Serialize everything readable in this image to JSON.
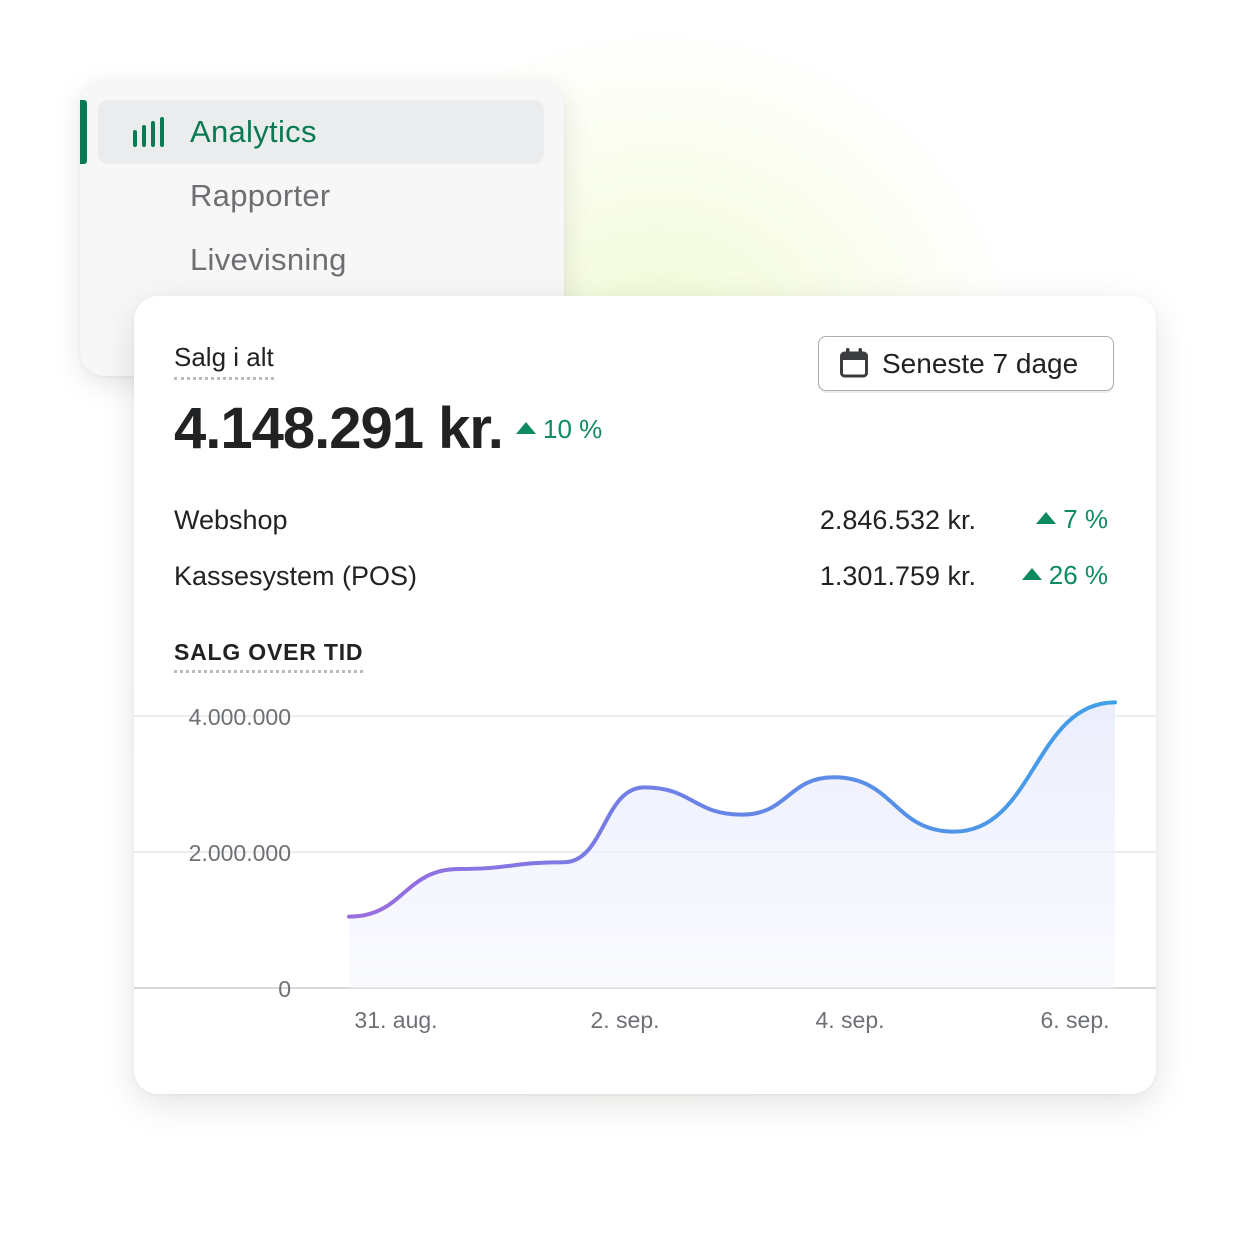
{
  "nav": {
    "items": [
      {
        "label": "Analytics",
        "active": true,
        "icon": "bar-chart-icon"
      },
      {
        "label": "Rapporter",
        "active": false
      },
      {
        "label": "Livevisning",
        "active": false
      }
    ]
  },
  "summary": {
    "title": "Salg i alt",
    "date_range": {
      "icon": "calendar-icon",
      "label": "Seneste 7 dage"
    },
    "total": "4.148.291 kr.",
    "total_change": "10 %",
    "channels": [
      {
        "name": "Webshop",
        "value": "2.846.532 kr.",
        "change": "7 %"
      },
      {
        "name": "Kassesystem (POS)",
        "value": "1.301.759 kr.",
        "change": "26 %"
      }
    ]
  },
  "colors": {
    "accent": "#0b7a53",
    "trend_up": "#0e8a63",
    "line_start": "#9a6ce0",
    "line_end": "#3fa0e8"
  },
  "chart_title": "SALG OVER TID",
  "chart_data": {
    "type": "line",
    "title": "SALG OVER TID",
    "xlabel": "",
    "ylabel": "",
    "x_ticks": [
      "31. aug.",
      "2. sep.",
      "4. sep.",
      "6. sep."
    ],
    "y_ticks": [
      "0",
      "2.000.000",
      "4.000.000"
    ],
    "ylim": [
      0,
      4000000
    ],
    "grid": true,
    "area_fill": true,
    "points": [
      {
        "x": "30. aug.",
        "y": 1050000
      },
      {
        "x": "31. aug.",
        "y": 1750000
      },
      {
        "x": "1. sep.",
        "y": 1850000
      },
      {
        "x": "1,5. sep.",
        "y": 2950000
      },
      {
        "x": "2,5. sep.",
        "y": 2550000
      },
      {
        "x": "3,5. sep.",
        "y": 3100000
      },
      {
        "x": "4,5. sep.",
        "y": 2300000
      },
      {
        "x": "6. sep.",
        "y": 4200000
      }
    ]
  }
}
